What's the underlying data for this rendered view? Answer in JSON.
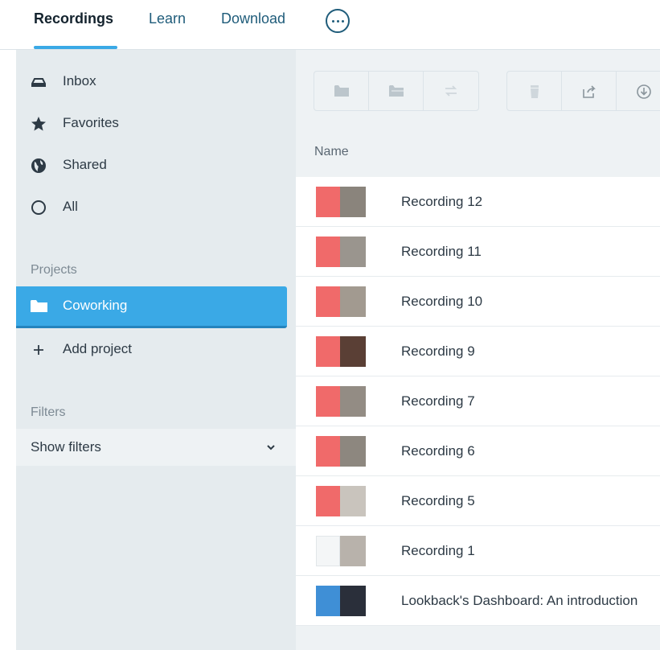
{
  "topnav": {
    "tabs": [
      {
        "label": "Recordings",
        "active": true
      },
      {
        "label": "Learn",
        "active": false
      },
      {
        "label": "Download",
        "active": false
      }
    ],
    "more_icon": "ellipsis-circle-icon"
  },
  "sidebar": {
    "items": [
      {
        "label": "Inbox",
        "icon": "inbox-icon"
      },
      {
        "label": "Favorites",
        "icon": "star-icon"
      },
      {
        "label": "Shared",
        "icon": "globe-icon"
      },
      {
        "label": "All",
        "icon": "circle-icon"
      }
    ],
    "projects_title": "Projects",
    "active_project": "Coworking",
    "add_project": "Add project",
    "filters_title": "Filters",
    "show_filters": "Show filters"
  },
  "main": {
    "column_header": "Name",
    "toolbar_icons": [
      "folder-icon",
      "folder-move-icon",
      "swap-icon",
      "trash-icon",
      "share-icon",
      "download-icon"
    ],
    "recordings": [
      "Recording 12",
      "Recording 11",
      "Recording 10",
      "Recording 9",
      "Recording 7",
      "Recording 6",
      "Recording 5",
      "Recording 1",
      "Lookback's Dashboard: An introduction"
    ]
  },
  "colors": {
    "accent": "#3aa9e6",
    "sidebar_bg": "#e5ebee",
    "thumb_pink": "#f06a6a",
    "nav_text": "#1f5c7a"
  }
}
